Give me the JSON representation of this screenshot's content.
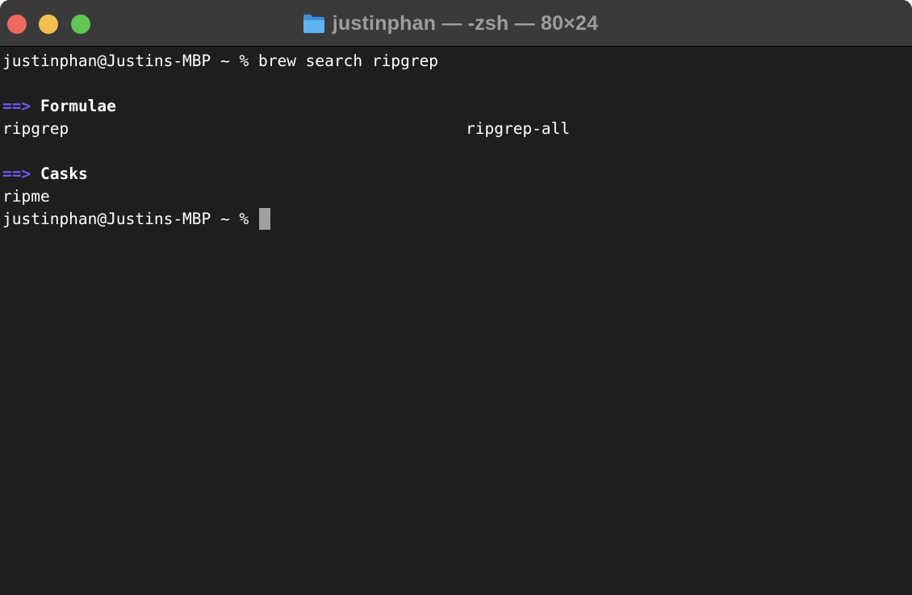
{
  "window": {
    "title": "justinphan — -zsh — 80×24"
  },
  "icons": {
    "title_folder": "folder-icon"
  },
  "colors": {
    "background": "#1e1e1e",
    "titlebar": "#3a3a3a",
    "text": "#ffffff",
    "arrow": "#6a5bf5",
    "cursor": "#a0a0a0",
    "close": "#ee6a5e",
    "minimize": "#f5bf4f",
    "maximize": "#62c655"
  },
  "terminal": {
    "prompt": "justinphan@Justins-MBP ~ % ",
    "command": "brew search ripgrep",
    "arrow": "==>",
    "formulae_heading": "Formulae",
    "formulae": [
      "ripgrep",
      "ripgrep-all"
    ],
    "casks_heading": "Casks",
    "casks": [
      "ripme"
    ],
    "final_prompt": "justinphan@Justins-MBP ~ % "
  }
}
